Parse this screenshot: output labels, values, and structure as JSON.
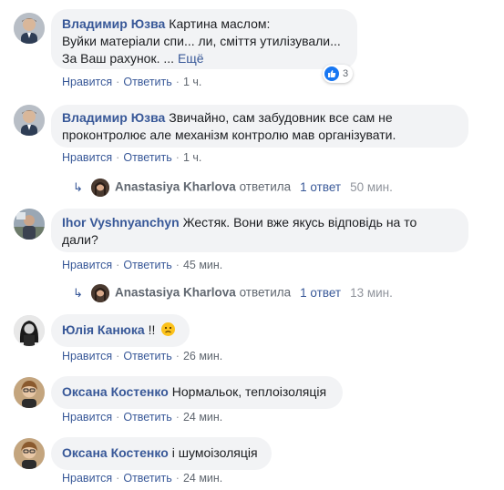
{
  "comments": [
    {
      "author": "Владимир Юзва",
      "lines": [
        "Картина маслом:",
        "Вуйки матеріали спи... ли, сміття утилізували...",
        "За Ваш рахунок. ..."
      ],
      "more": "Ещё",
      "reaction_count": "3",
      "like": "Нравится",
      "reply": "Ответить",
      "time": "1 ч."
    },
    {
      "author": "Владимир Юзва",
      "lines": [
        "Звичайно, сам забудовник все сам не",
        "проконтролює але механізм контролю мав організувати."
      ],
      "like": "Нравится",
      "reply": "Ответить",
      "time": "1 ч.",
      "replies": {
        "name": "Anastasiya Kharlova",
        "verb": "ответила",
        "count": "1 ответ",
        "time": "50 мин."
      }
    },
    {
      "author": "Ihor Vyshnyanchyn",
      "lines": [
        "Жестяк. Вони вже якусь відповідь на то",
        "дали?"
      ],
      "like": "Нравится",
      "reply": "Ответить",
      "time": "45 мин.",
      "replies": {
        "name": "Anastasiya Kharlova",
        "verb": "ответила",
        "count": "1 ответ",
        "time": "13 мин."
      }
    },
    {
      "author": "Юлія Канюка",
      "text": "!!",
      "emoji": "disappointed-emoji",
      "like": "Нравится",
      "reply": "Ответить",
      "time": "26 мин."
    },
    {
      "author": "Оксана Костенко",
      "text": "Нормальок, теплоізоляція",
      "like": "Нравится",
      "reply": "Ответить",
      "time": "24 мин."
    },
    {
      "author": "Оксана Костенко",
      "text": "і шумоізоляція",
      "like": "Нравится",
      "reply": "Ответить",
      "time": "24 мин."
    }
  ],
  "colors": {
    "link": "#385898",
    "bubble": "#f2f3f5",
    "meta": "#606770",
    "like_blue": "#1877f2"
  }
}
